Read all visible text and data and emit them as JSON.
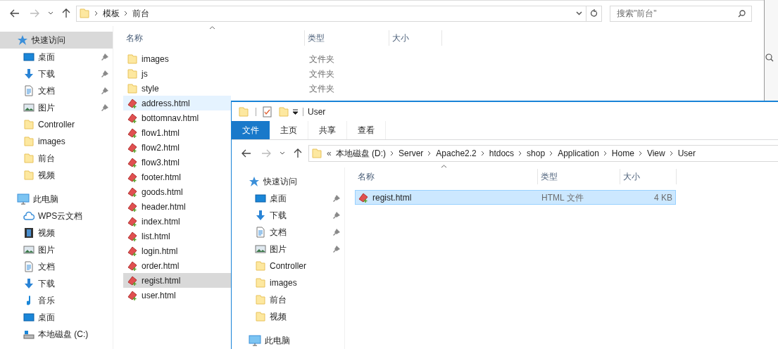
{
  "back_window": {
    "address": {
      "crumbs": [
        "模板",
        "前台"
      ]
    },
    "search": {
      "placeholder": "搜索\"前台\""
    },
    "nav": [
      {
        "label": "快速访问",
        "kind": "star",
        "pinned": false,
        "selected": true,
        "group": true
      },
      {
        "label": "桌面",
        "kind": "desktop",
        "pinned": true,
        "selected": false
      },
      {
        "label": "下载",
        "kind": "download",
        "pinned": true,
        "selected": false
      },
      {
        "label": "文档",
        "kind": "doc",
        "pinned": true,
        "selected": false
      },
      {
        "label": "图片",
        "kind": "picture",
        "pinned": true,
        "selected": false
      },
      {
        "label": "Controller",
        "kind": "folder",
        "pinned": false,
        "selected": false
      },
      {
        "label": "images",
        "kind": "folder",
        "pinned": false,
        "selected": false
      },
      {
        "label": "前台",
        "kind": "folder",
        "pinned": false,
        "selected": false
      },
      {
        "label": "视频",
        "kind": "folder",
        "pinned": false,
        "selected": false
      },
      {
        "label": "此电脑",
        "kind": "pc",
        "pinned": false,
        "selected": false,
        "group": true
      },
      {
        "label": "WPS云文档",
        "kind": "cloud",
        "pinned": false,
        "selected": false
      },
      {
        "label": "视频",
        "kind": "video",
        "pinned": false,
        "selected": false
      },
      {
        "label": "图片",
        "kind": "picture",
        "pinned": false,
        "selected": false
      },
      {
        "label": "文档",
        "kind": "doc",
        "pinned": false,
        "selected": false
      },
      {
        "label": "下载",
        "kind": "download",
        "pinned": false,
        "selected": false
      },
      {
        "label": "音乐",
        "kind": "music",
        "pinned": false,
        "selected": false
      },
      {
        "label": "桌面",
        "kind": "desktop",
        "pinned": false,
        "selected": false
      },
      {
        "label": "本地磁盘 (C:)",
        "kind": "drive",
        "pinned": false,
        "selected": false
      }
    ],
    "columns": [
      "名称",
      "类型",
      "大小"
    ],
    "files": [
      {
        "name": "images",
        "kind": "folder",
        "type": "文件夹",
        "selected": false,
        "hovered": false
      },
      {
        "name": "js",
        "kind": "folder",
        "type": "文件夹",
        "selected": false,
        "hovered": false
      },
      {
        "name": "style",
        "kind": "folder",
        "type": "文件夹",
        "selected": false,
        "hovered": false
      },
      {
        "name": "address.html",
        "kind": "html",
        "selected": false,
        "hovered": true
      },
      {
        "name": "bottomnav.html",
        "kind": "html",
        "selected": false,
        "hovered": false
      },
      {
        "name": "flow1.html",
        "kind": "html",
        "selected": false,
        "hovered": false
      },
      {
        "name": "flow2.html",
        "kind": "html",
        "selected": false,
        "hovered": false
      },
      {
        "name": "flow3.html",
        "kind": "html",
        "selected": false,
        "hovered": false
      },
      {
        "name": "footer.html",
        "kind": "html",
        "selected": false,
        "hovered": false
      },
      {
        "name": "goods.html",
        "kind": "html",
        "selected": false,
        "hovered": false
      },
      {
        "name": "header.html",
        "kind": "html",
        "selected": false,
        "hovered": false
      },
      {
        "name": "index.html",
        "kind": "html",
        "selected": false,
        "hovered": false
      },
      {
        "name": "list.html",
        "kind": "html",
        "selected": false,
        "hovered": false
      },
      {
        "name": "login.html",
        "kind": "html",
        "selected": false,
        "hovered": false
      },
      {
        "name": "order.html",
        "kind": "html",
        "selected": false,
        "hovered": false
      },
      {
        "name": "regist.html",
        "kind": "html",
        "selected": true,
        "hovered": false
      },
      {
        "name": "user.html",
        "kind": "html",
        "selected": false,
        "hovered": false
      }
    ]
  },
  "front_window": {
    "title": "User",
    "ribbon_tabs": [
      {
        "label": "文件",
        "selected": true
      },
      {
        "label": "主页",
        "selected": false
      },
      {
        "label": "共享",
        "selected": false
      },
      {
        "label": "查看",
        "selected": false
      }
    ],
    "address": {
      "overflow": "«",
      "crumbs": [
        "本地磁盘 (D:)",
        "Server",
        "Apache2.2",
        "htdocs",
        "shop",
        "Application",
        "Home",
        "View",
        "User"
      ]
    },
    "nav": [
      {
        "label": "快速访问",
        "kind": "star",
        "pinned": false,
        "group": true
      },
      {
        "label": "桌面",
        "kind": "desktop",
        "pinned": true
      },
      {
        "label": "下载",
        "kind": "download",
        "pinned": true
      },
      {
        "label": "文档",
        "kind": "doc",
        "pinned": true
      },
      {
        "label": "图片",
        "kind": "picture",
        "pinned": true
      },
      {
        "label": "Controller",
        "kind": "folder",
        "pinned": false
      },
      {
        "label": "images",
        "kind": "folder",
        "pinned": false
      },
      {
        "label": "前台",
        "kind": "folder",
        "pinned": false
      },
      {
        "label": "视频",
        "kind": "folder",
        "pinned": false
      },
      {
        "label": "此电脑",
        "kind": "pc",
        "pinned": false,
        "group": true
      }
    ],
    "columns": [
      "名称",
      "类型",
      "大小"
    ],
    "files": [
      {
        "name": "regist.html",
        "kind": "html",
        "type": "HTML 文件",
        "size": "4 KB",
        "selected": true
      }
    ]
  }
}
